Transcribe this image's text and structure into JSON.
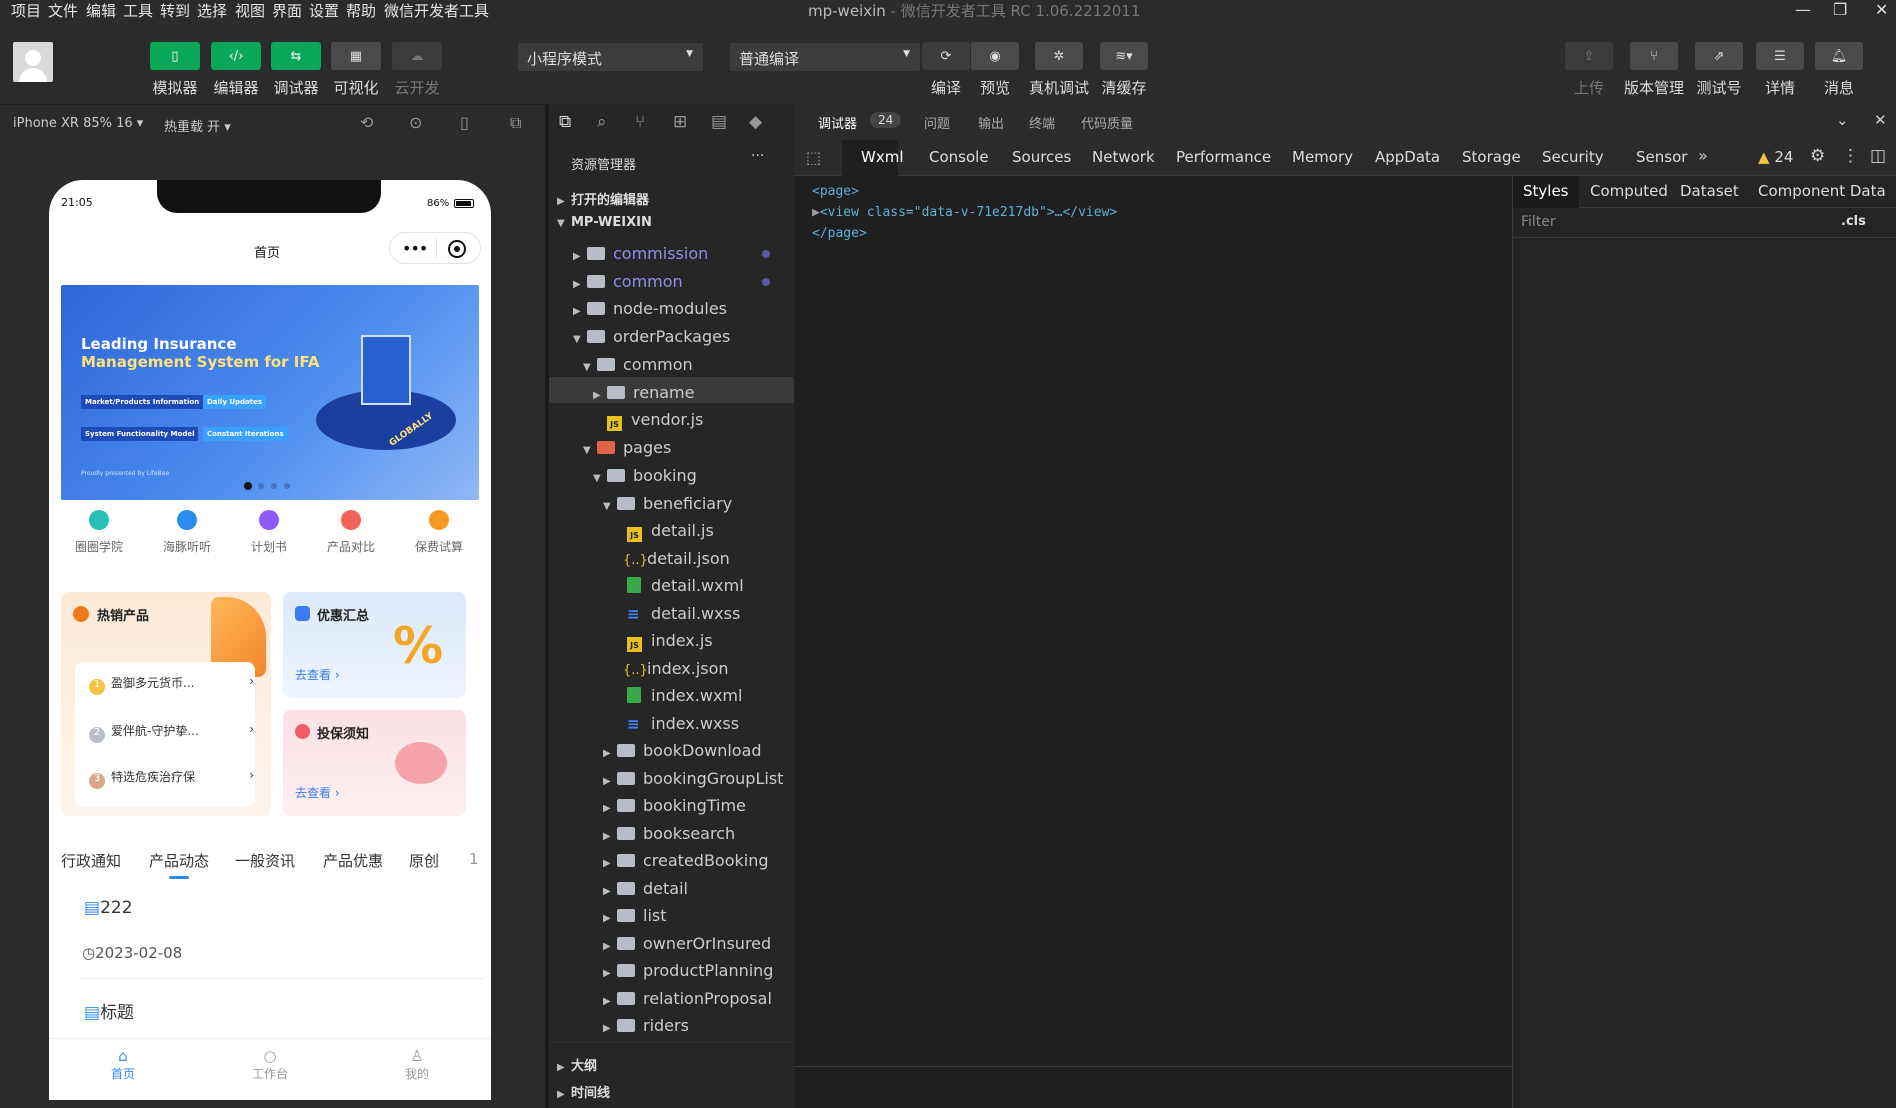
{
  "menu": [
    "项目",
    "文件",
    "编辑",
    "工具",
    "转到",
    "选择",
    "视图",
    "界面",
    "设置",
    "帮助",
    "微信开发者工具"
  ],
  "window": {
    "title": "mp-weixin",
    "subtitle": "- 微信开发者工具 RC 1.06.2212011"
  },
  "toolbar": {
    "left": [
      {
        "label": "模拟器",
        "icon": "phone-icon"
      },
      {
        "label": "编辑器",
        "icon": "code-icon"
      },
      {
        "label": "调试器",
        "icon": "debug-icon"
      },
      {
        "label": "可视化",
        "icon": "layout-icon"
      },
      {
        "label": "云开发",
        "icon": "cloud-icon"
      }
    ],
    "mode_select": "小程序模式",
    "compile_select": "普通编译",
    "mid": [
      {
        "label": "编译"
      },
      {
        "label": "预览"
      },
      {
        "label": "真机调试"
      },
      {
        "label": "清缓存"
      }
    ],
    "right": [
      {
        "label": "上传"
      },
      {
        "label": "版本管理"
      },
      {
        "label": "测试号"
      },
      {
        "label": "详情"
      },
      {
        "label": "消息"
      }
    ]
  },
  "simulator": {
    "device": "iPhone XR 85% 16",
    "hotreload": "热重载 开",
    "time": "21:05",
    "battery": "86%",
    "page_title": "首页",
    "banner": {
      "line1": "Leading Insurance",
      "line2": "Management System for IFA",
      "tags": [
        "Market/Products Information",
        "Daily Updates",
        "System Functionality Model",
        "Constant Iterations"
      ],
      "footer": "Proudly presented by LifeBee",
      "badge": "GLOBALLY"
    },
    "quick": [
      {
        "label": "圈圈学院",
        "color": "#26c0b5"
      },
      {
        "label": "海豚听听",
        "color": "#2d8cf0"
      },
      {
        "label": "计划书",
        "color": "#8b5cf6"
      },
      {
        "label": "产品对比",
        "color": "#f2645a"
      },
      {
        "label": "保费试算",
        "color": "#f59a23"
      }
    ],
    "hot": {
      "title": "热销产品",
      "items": [
        {
          "num": "1",
          "text": "盈御多元货币..."
        },
        {
          "num": "2",
          "text": "爱伴航-守护挚..."
        },
        {
          "num": "3",
          "text": "特选危疾治疗保"
        }
      ]
    },
    "promo": {
      "title": "优惠汇总",
      "link": "去查看"
    },
    "notice": {
      "title": "投保须知",
      "link": "去查看"
    },
    "tabs": [
      "行政通知",
      "产品动态",
      "一般资讯",
      "产品优惠",
      "原创",
      "1"
    ],
    "list": [
      {
        "title": "222",
        "date": "2023-02-08"
      },
      {
        "title": "标题"
      }
    ],
    "nav": [
      {
        "label": "首页"
      },
      {
        "label": "工作台"
      },
      {
        "label": "我的"
      }
    ]
  },
  "explorer": {
    "title": "资源管理器",
    "sec_open": "打开的编辑器",
    "root": "MP-WEIXIN",
    "outline": "大纲",
    "timeline": "时间线",
    "items": [
      "commission",
      "common",
      "node-modules",
      "orderPackages",
      "common",
      "rename",
      "vendor.js",
      "pages",
      "booking",
      "beneficiary",
      "detail.js",
      "detail.json",
      "detail.wxml",
      "detail.wxss",
      "index.js",
      "index.json",
      "index.wxml",
      "index.wxss",
      "bookDownload",
      "bookingGroupList",
      "bookingTime",
      "booksearch",
      "createdBooking",
      "detail",
      "list",
      "ownerOrInsured",
      "productPlanning",
      "relationProposal",
      "riders"
    ]
  },
  "devtools": {
    "top_tabs": [
      "调试器",
      "问题",
      "输出",
      "终端",
      "代码质量"
    ],
    "badge": "24",
    "tabs": [
      "Wxml",
      "Console",
      "Sources",
      "Network",
      "Performance",
      "Memory",
      "AppData",
      "Storage",
      "Security",
      "Sensor"
    ],
    "warn": "24",
    "code": [
      "<page>",
      "<view class=\"data-v-71e217db\">…</view>",
      "</page>"
    ],
    "styles_tabs": [
      "Styles",
      "Computed",
      "Dataset",
      "Component Data"
    ],
    "filter": "Filter",
    "cls": ".cls"
  }
}
